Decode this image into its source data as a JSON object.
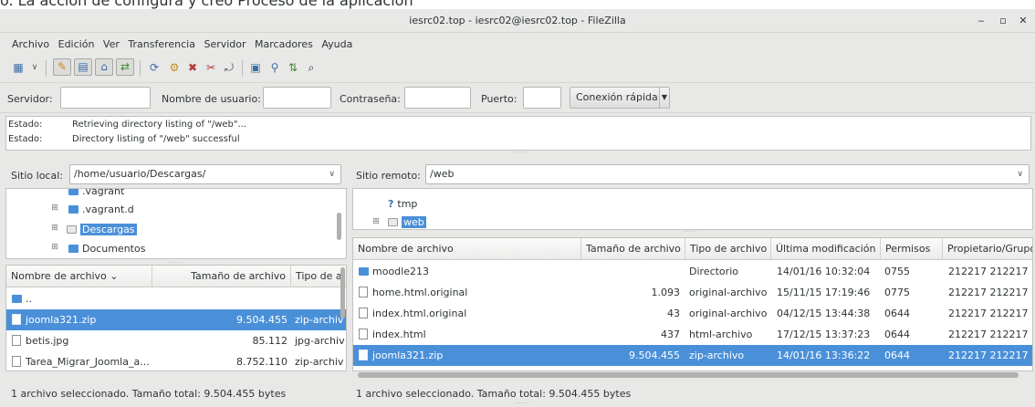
{
  "window": {
    "title": "iesrc02.top - iesrc02@iesrc02.top - FileZilla",
    "top_cut_text": "o. La acción dé configurá y creó Proceso de la aplicación"
  },
  "menu": [
    "Archivo",
    "Edición",
    "Ver",
    "Transferencia",
    "Servidor",
    "Marcadores",
    "Ayuda"
  ],
  "quickconnect": {
    "host_label": "Servidor:",
    "user_label": "Nombre de usuario:",
    "pass_label": "Contraseña:",
    "port_label": "Puerto:",
    "connect_button": "Conexión rápida",
    "host_value": "",
    "user_value": "",
    "pass_value": "",
    "port_value": ""
  },
  "log": [
    {
      "key": "Estado:",
      "msg": "Retrieving directory listing of \"/web\"..."
    },
    {
      "key": "Estado:",
      "msg": "Directory listing of \"/web\" successful"
    }
  ],
  "local": {
    "label": "Sitio local:",
    "path": "/home/usuario/Descargas/",
    "tree": [
      {
        "name": ".vagrant",
        "exp": ""
      },
      {
        "name": ".vagrant.d",
        "exp": "⊞"
      },
      {
        "name": "Descargas",
        "exp": "⊞"
      },
      {
        "name": "Documentos",
        "exp": "⊞"
      }
    ],
    "headers": [
      "Nombre de archivo",
      "Tamaño de archivo",
      "Tipo de a"
    ],
    "files": [
      {
        "name": "..",
        "size": "",
        "type": ""
      },
      {
        "name": "joomla321.zip",
        "size": "9.504.455",
        "type": "zip-archiv"
      },
      {
        "name": "betis.jpg",
        "size": "85.112",
        "type": "jpg-archiv"
      },
      {
        "name": "Tarea_Migrar_Joomla_a...",
        "size": "8.752.110",
        "type": "zip-archiv"
      }
    ],
    "status": "1 archivo seleccionado. Tamaño total: 9.504.455 bytes"
  },
  "remote": {
    "label": "Sitio remoto:",
    "path": "/web",
    "tree": [
      {
        "name": "tmp",
        "exp": ""
      },
      {
        "name": "web",
        "exp": "⊞"
      }
    ],
    "headers": [
      "Nombre de archivo",
      "Tamaño de archivo",
      "Tipo de archivo",
      "Última modificación",
      "Permisos",
      "Propietario/Grupo"
    ],
    "files": [
      {
        "name": "moodle213",
        "size": "",
        "type": "Directorio",
        "modified": "14/01/16 10:32:04",
        "perms": "0755",
        "owner": "212217 212217"
      },
      {
        "name": "home.html.original",
        "size": "1.093",
        "type": "original-archivo",
        "modified": "15/11/15 17:19:46",
        "perms": "0775",
        "owner": "212217 212217"
      },
      {
        "name": "index.html.original",
        "size": "43",
        "type": "original-archivo",
        "modified": "04/12/15 13:44:38",
        "perms": "0644",
        "owner": "212217 212217"
      },
      {
        "name": "index.html",
        "size": "437",
        "type": "html-archivo",
        "modified": "17/12/15 13:37:23",
        "perms": "0644",
        "owner": "212217 212217"
      },
      {
        "name": "joomla321.zip",
        "size": "9.504.455",
        "type": "zip-archivo",
        "modified": "14/01/16 13:36:22",
        "perms": "0644",
        "owner": "212217 212217"
      }
    ],
    "status": "1 archivo seleccionado. Tamaño total: 9.504.455 bytes"
  },
  "colors": {
    "selection": "#4a90d9",
    "folder": "#4a90d9"
  }
}
